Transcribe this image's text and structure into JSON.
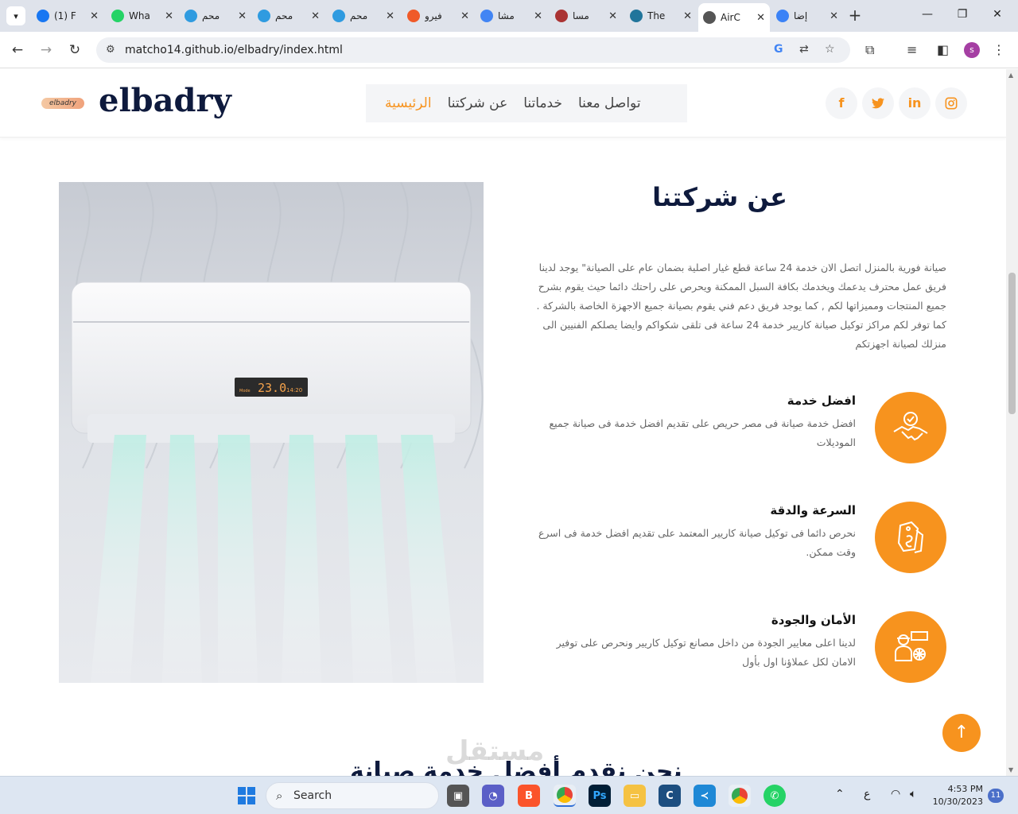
{
  "browser": {
    "tabs": [
      {
        "label": "(1) F",
        "icon": "facebook-icon",
        "color": "#1877f2"
      },
      {
        "label": "Wha",
        "icon": "whatsapp-icon",
        "color": "#25d366"
      },
      {
        "label": "محم",
        "icon": "cart-icon",
        "color": "#2f9be0"
      },
      {
        "label": "محم",
        "icon": "cart-icon",
        "color": "#2f9be0"
      },
      {
        "label": "محم",
        "icon": "cart-icon",
        "color": "#2f9be0"
      },
      {
        "label": "فيرو",
        "icon": "fiverr-icon",
        "color": "#f05a28"
      },
      {
        "label": "مشا",
        "icon": "google-icon",
        "color": "#4285f4"
      },
      {
        "label": "مسا",
        "icon": "doc-icon",
        "color": "#aa3333"
      },
      {
        "label": "The",
        "icon": "wordpress-icon",
        "color": "#21759b"
      },
      {
        "label": "AirC",
        "icon": "globe-icon",
        "color": "#555555"
      },
      {
        "label": "إضا",
        "icon": "circle-icon",
        "color": "#3b82f6"
      }
    ],
    "url": "matcho14.github.io/elbadry/index.html",
    "profile_initial": "s"
  },
  "site": {
    "logo_small": "elbadry",
    "logo_text": "elbadry",
    "menu": [
      "الرئيسية",
      "عن شركتنا",
      "خدماتنا",
      "تواصل معنا"
    ],
    "social": [
      "f",
      "t",
      "in",
      "ig"
    ],
    "accent": "#f7931e",
    "section_title": "عن شركتنا",
    "about_text": "صيانة فورية بالمنزل اتصل الان خدمة 24 ساعة قطع غيار اصلية بضمان عام على الصيانة\" يوجد لدينا فريق عمل محترف يدعمك ويخدمك بكافة السبل الممكنة ويحرص على راحتك دائما حيث يقوم بشرح جميع المنتجات ومميزاتها لكم , كما يوجد فريق دعم فني يقوم بصيانة جميع الاجهزة الخاصة بالشركة . كما توفر لكم مراكز توكيل صيانة كاريير خدمة 24 ساعة فى تلقى شكواكم وايضا يصلكم الفنيين الى منزلك لصيانة اجهزتكم",
    "ac_display": "23.0",
    "ac_time": "14:20",
    "ac_mode": "Mode",
    "features": [
      {
        "title": "افضل خدمة",
        "desc": "افضل خدمة صيانة فى مصر حريص على تقديم افضل خدمة فى صيانة جميع الموديلات",
        "icon": "handshake-icon"
      },
      {
        "title": "السرعة والدقة",
        "desc": "نحرص دائما فى توكيل صيانة كاريير المعتمد على تقديم افضل خدمة فى اسرع وقت ممكن.",
        "icon": "price-tag-icon"
      },
      {
        "title": "الأمان والجودة",
        "desc": "لدينا اعلى معايير الجودة من داخل مصانع توكيل كاريير ونحرص على توفير الامان لكل عملاؤنا اول بأول",
        "icon": "technician-icon"
      }
    ],
    "next_section_title": "نحن نقدم أفضل خدمة صيانة",
    "watermark": "مستقل"
  },
  "taskbar": {
    "search_placeholder": "Search",
    "time": "4:53 PM",
    "date": "10/30/2023",
    "notifications": "11",
    "lang": "ع"
  }
}
